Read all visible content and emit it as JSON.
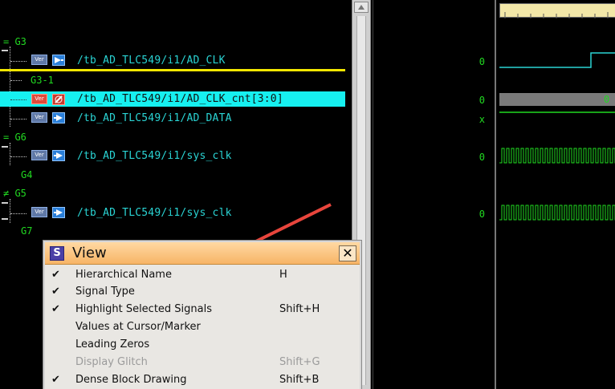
{
  "groups": [
    "G3",
    "G3-1",
    "G6",
    "G4",
    "G5",
    "G7"
  ],
  "signals": [
    {
      "path": "/tb_AD_TLC549/i1/AD_CLK",
      "badge": "Ver",
      "value": "0"
    },
    {
      "path": "/tb_AD_TLC549/i1/AD_CLK_cnt[3:0]",
      "badge": "Ver",
      "value": "0"
    },
    {
      "path": "/tb_AD_TLC549/i1/AD_DATA",
      "badge": "Ver",
      "value": "x"
    },
    {
      "path": "/tb_AD_TLC549/i1/sys_clk",
      "badge": "Ver",
      "value": "0"
    },
    {
      "path": "/tb_AD_TLC549/i1/sys_clk",
      "badge": "Ver",
      "value": "0"
    }
  ],
  "wave": {
    "bus_value": "0"
  },
  "dialog": {
    "icon_letter": "S",
    "title": "View",
    "close_glyph": "✕",
    "items": [
      {
        "label": "Hierarchical Name",
        "shortcut": "H",
        "checked": "✔"
      },
      {
        "label": "Signal Type",
        "shortcut": "",
        "checked": "✔"
      },
      {
        "label": "Highlight Selected Signals",
        "shortcut": "Shift+H",
        "checked": "✔"
      },
      {
        "label": "Values at Cursor/Marker",
        "shortcut": "",
        "checked": ""
      },
      {
        "label": "Leading Zeros",
        "shortcut": "",
        "checked": ""
      },
      {
        "label": "Display Glitch",
        "shortcut": "Shift+G",
        "checked": ""
      },
      {
        "label": "Dense Block Drawing",
        "shortcut": "Shift+B",
        "checked": "✔"
      }
    ]
  },
  "colors": {
    "accent_line": "#f2e600",
    "selection": "#16f0f0",
    "signal_text": "#2ad4d4",
    "group_text": "#21d921",
    "annotation_arrow": "#e8453c"
  }
}
